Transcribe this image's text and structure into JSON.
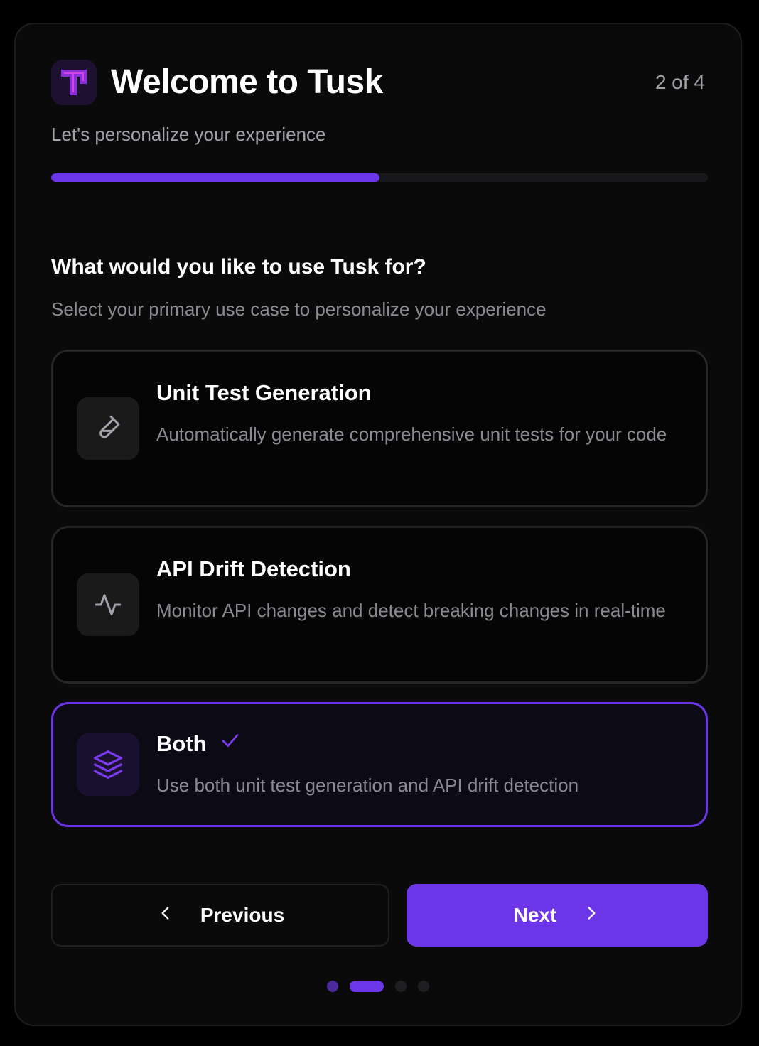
{
  "header": {
    "logo_icon": "tusk-logo-icon",
    "title": "Welcome to Tusk",
    "step_indicator": "2 of 4",
    "subtitle": "Let's personalize your experience",
    "progress_fraction": 0.5
  },
  "question": {
    "title": "What would you like to use Tusk for?",
    "subtitle": "Select your primary use case to personalize your experience"
  },
  "options": [
    {
      "icon": "test-tube-icon",
      "title": "Unit Test Generation",
      "description": "Automatically generate comprehensive unit tests for your code",
      "selected": false
    },
    {
      "icon": "activity-icon",
      "title": "API Drift Detection",
      "description": "Monitor API changes and detect breaking changes in real-time",
      "selected": false
    },
    {
      "icon": "layers-icon",
      "title": "Both",
      "description": "Use both unit test generation and API drift detection",
      "selected": true
    }
  ],
  "buttons": {
    "previous_label": "Previous",
    "next_label": "Next"
  },
  "pagination": {
    "total_steps": 4,
    "current_step": 2
  },
  "colors": {
    "accent": "#6d35e8",
    "background": "#0a0a0a",
    "text_primary": "#ffffff",
    "text_secondary": "#8a8a92"
  }
}
